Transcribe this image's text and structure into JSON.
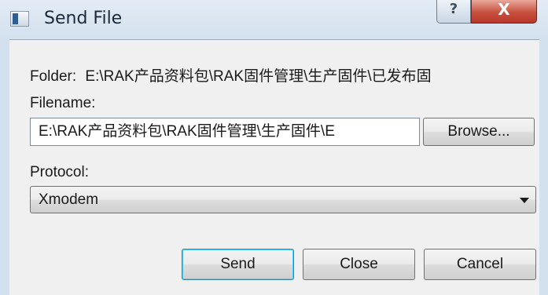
{
  "window": {
    "title": "Send File",
    "help_glyph": "?",
    "close_glyph": "X"
  },
  "folder": {
    "label": "Folder:",
    "path": "E:\\RAK产品资料包\\RAK固件管理\\生产固件\\已发布固"
  },
  "filename": {
    "label": "Filename:",
    "value": "E:\\RAK产品资料包\\RAK固件管理\\生产固件\\E",
    "browse_label": "Browse..."
  },
  "protocol": {
    "label": "Protocol:",
    "selected": "Xmodem"
  },
  "buttons": {
    "send": "Send",
    "close": "Close",
    "cancel": "Cancel"
  },
  "icons": {
    "app": "send-file-app-icon",
    "dropdown": "chevron-down-icon"
  },
  "colors": {
    "titlebar": "#d3e0ee",
    "close_button": "#c7503d",
    "default_button_border": "#3c7fb1"
  }
}
